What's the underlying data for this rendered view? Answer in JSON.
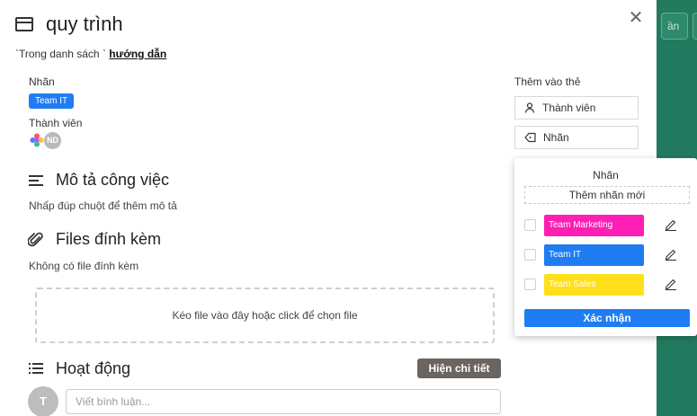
{
  "background": {
    "buttons": [
      "ần",
      ""
    ]
  },
  "card": {
    "title": "quy trình",
    "list_prefix": "`Trong danh sách `",
    "list_name": "hướng dẫn",
    "labels_heading": "Nhãn",
    "label_chip": "Team IT",
    "members_heading": "Thành viên",
    "member_initials": "ND",
    "description_title": "Mô tả công việc",
    "description_placeholder": "Nhấp đúp chuột để thêm mô tả",
    "attachments_title": "Files đính kèm",
    "attachments_empty": "Không có file đính kèm",
    "dropzone_text": "Kéo file vào đây hoặc click để chọn file",
    "activity_title": "Hoạt động",
    "show_details_label": "Hiện chi tiết",
    "comment_avatar_initial": "T",
    "comment_placeholder": "Viết bình luận..."
  },
  "sidebar": {
    "add_to_card_heading": "Thêm vào thẻ",
    "members_button": "Thành viên",
    "labels_button": "Nhãn"
  },
  "label_popover": {
    "title": "Nhãn",
    "add_new_label": "Thêm nhãn mới",
    "labels": [
      {
        "name": "Team Marketing",
        "color": "#ff1eb4"
      },
      {
        "name": "Team IT",
        "color": "#1f7cf2"
      },
      {
        "name": "Team Sales",
        "color": "#ffdf1a"
      }
    ],
    "confirm_label": "Xác nhận"
  },
  "colors": {
    "accent": "#1f7cf2",
    "board_background": "#1f7a63"
  }
}
